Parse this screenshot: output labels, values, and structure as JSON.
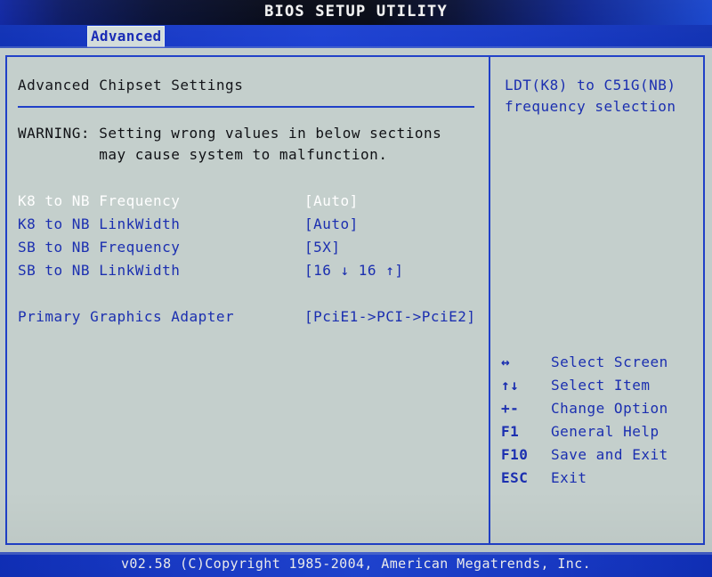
{
  "header": {
    "title": "BIOS SETUP UTILITY",
    "tabs": [
      {
        "label": "Advanced",
        "active": true
      }
    ]
  },
  "main": {
    "pane_title": "Advanced Chipset Settings",
    "warning": {
      "line1": "WARNING: Setting wrong values in below sections",
      "line2": "         may cause system to malfunction."
    },
    "settings": [
      {
        "label": "K8 to NB Frequency",
        "value": "[Auto]",
        "selected": true
      },
      {
        "label": "K8 to NB LinkWidth",
        "value": "[Auto]",
        "selected": false
      },
      {
        "label": "SB to NB Frequency",
        "value": "[5X]",
        "selected": false
      },
      {
        "label": "SB to NB LinkWidth",
        "value": "[16 ↓ 16 ↑]",
        "selected": false
      },
      {
        "label": "Primary Graphics Adapter",
        "value": "[PciE1->PCI->PciE2]",
        "selected": false
      }
    ]
  },
  "help": {
    "line1": "LDT(K8) to C51G(NB)",
    "line2": "frequency selection"
  },
  "keys": [
    {
      "keys": "↔",
      "desc": "Select Screen"
    },
    {
      "keys": "↑↓",
      "desc": "Select Item"
    },
    {
      "keys": "+-",
      "desc": "Change Option"
    },
    {
      "keys": "F1",
      "desc": "General Help"
    },
    {
      "keys": "F10",
      "desc": "Save and Exit"
    },
    {
      "keys": "ESC",
      "desc": "Exit"
    }
  ],
  "footer": {
    "text": "v02.58 (C)Copyright 1985-2004, American Megatrends, Inc."
  },
  "colors": {
    "screen_bg": "#c4cfcc",
    "frame_border": "#2040c8",
    "text_blue": "#1b2fb0",
    "text_black": "#101115",
    "text_selected": "#ffffff",
    "titlebar_dark": "#010410",
    "bar_blue": "#1a3fd2"
  }
}
